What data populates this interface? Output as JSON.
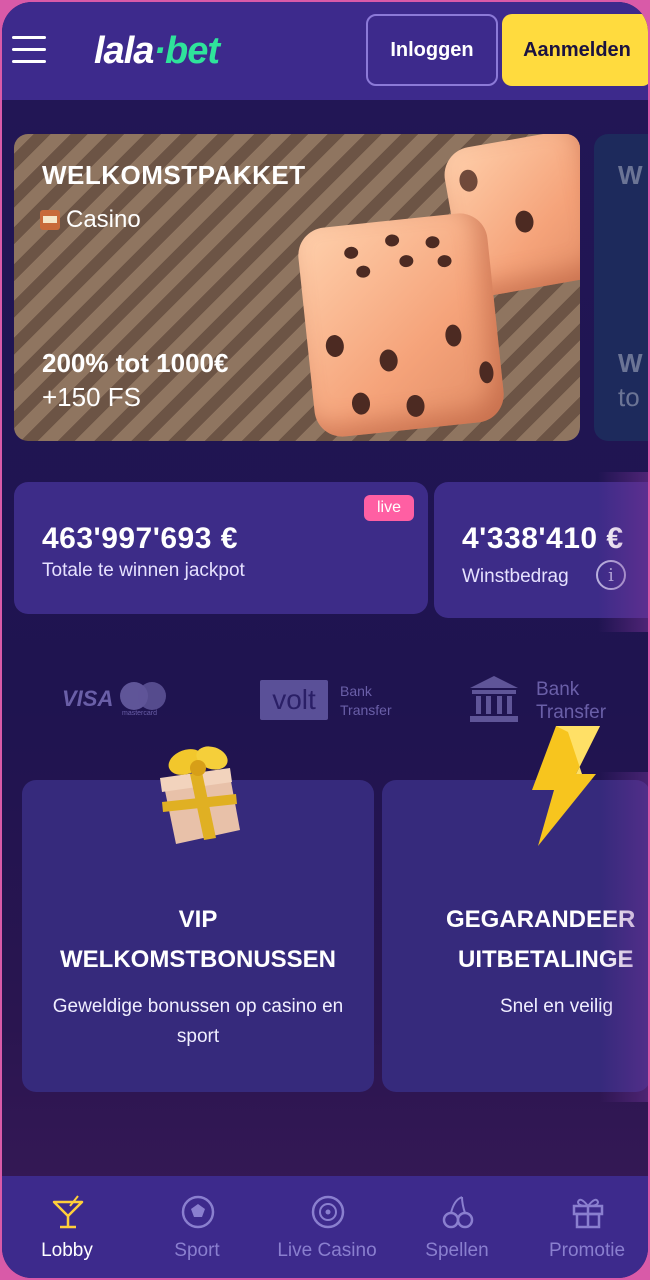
{
  "header": {
    "logo_part1": "lala",
    "logo_dot": "·",
    "logo_part2": "bet",
    "login_label": "Inloggen",
    "register_label": "Aanmelden"
  },
  "promo": {
    "title": "WELKOMSTPAKKET",
    "category": "Casino",
    "offer": "200% tot 1000€",
    "free_spins": "+150 FS",
    "next_title_partial": "W",
    "next_offer_partial": "W",
    "next_offer2_partial": "to"
  },
  "jackpot": {
    "amount": "463'997'693 €",
    "label": "Totale te winnen jackpot",
    "badge": "live"
  },
  "winnings": {
    "amount": "4'338'410 €",
    "label": "Winstbedrag"
  },
  "payments": {
    "visa": "VISA",
    "mastercard": "mastercard",
    "volt": "volt",
    "bank_transfer_small": [
      "Bank",
      "Transfer"
    ],
    "bank_transfer_large": [
      "Bank",
      "Transfer"
    ]
  },
  "features": [
    {
      "title_line1": "VIP",
      "title_line2": "WELKOMSTBONUSSEN",
      "sub_line1": "Geweldige bonussen op casino en",
      "sub_line2": "sport",
      "icon": "gift-icon"
    },
    {
      "title_line1": "GEGARANDEER",
      "title_line2": "UITBETALINGE",
      "sub_line1": "Snel en veilig",
      "sub_line2": "",
      "icon": "lightning-icon"
    }
  ],
  "nav": [
    {
      "label": "Lobby",
      "icon": "cocktail-icon",
      "active": true
    },
    {
      "label": "Sport",
      "icon": "soccer-ball-icon",
      "active": false
    },
    {
      "label": "Live Casino",
      "icon": "roulette-chip-icon",
      "active": false
    },
    {
      "label": "Spellen",
      "icon": "cherries-icon",
      "active": false
    },
    {
      "label": "Promotie",
      "icon": "gift-icon",
      "active": false
    }
  ],
  "colors": {
    "header_bg": "#3d2a8c",
    "page_bg": "#221656",
    "accent_green": "#2fe39b",
    "register_yellow": "#ffdb3e",
    "live_pink": "#ff5fa3"
  }
}
